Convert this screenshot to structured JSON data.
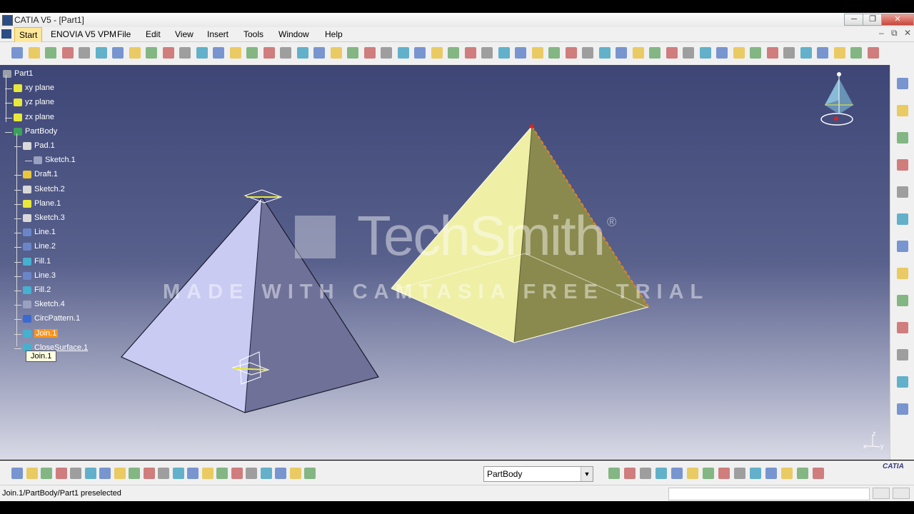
{
  "window": {
    "title": "CATIA V5 - [Part1]",
    "min_label": "─",
    "max_label": "❐",
    "close_label": "✕"
  },
  "menubar": {
    "items": [
      "Start",
      "ENOVIA V5 VPM",
      "File",
      "Edit",
      "View",
      "Insert",
      "Tools",
      "Window",
      "Help"
    ],
    "doc_controls": [
      "–",
      "⧉",
      "✕"
    ]
  },
  "tree": {
    "root": "Part1",
    "items": [
      "xy plane",
      "yz plane",
      "zx plane",
      "PartBody",
      "Pad.1",
      "Sketch.1",
      "Draft.1",
      "Sketch.2",
      "Plane.1",
      "Sketch.3",
      "Line.1",
      "Line.2",
      "Fill.1",
      "Line.3",
      "Fill.2",
      "Sketch.4",
      "CircPattern.1",
      "Join.1",
      "CloseSurface.1"
    ],
    "selected": "Join.1",
    "tooltip": "Join.1"
  },
  "watermark": {
    "brand": "TechSmith",
    "registered": "®",
    "tagline": "MADE WITH CAMTASIA FREE TRIAL"
  },
  "compass": {
    "axis_z": "z",
    "axis_x": "x",
    "axis_y": "y"
  },
  "bottom_toolbar": {
    "body_select_value": "PartBody",
    "logo": "CATIA"
  },
  "status": {
    "text": "Join.1/PartBody/Part1 preselected"
  },
  "colors": {
    "viewport_top": "#3d4676",
    "viewport_bottom": "#d9dae6",
    "left_pyramid_light": "#c9cbf2",
    "left_pyramid_dark": "#6f7199",
    "right_pyramid_light": "#efefa6",
    "right_pyramid_dark": "#8a8a4e",
    "selection_orange": "#e8801e",
    "highlight": "#f7941d"
  },
  "icons": {
    "top_toolbar": [
      "sketch-icon",
      "dim-icon",
      "part-icon",
      "pad-icon",
      "pocket-icon",
      "shaft-icon",
      "groove-icon",
      "hole-icon",
      "rib-icon",
      "slot-icon",
      "stiffener-icon",
      "loft-icon",
      "remove-loft-icon",
      "fillet-icon",
      "chamfer-icon",
      "draft-icon",
      "shell-icon",
      "thickness-icon",
      "thread-icon",
      "split-icon",
      "thick-surface-icon",
      "close-surface-icon",
      "sew-surface-icon",
      "translate-icon",
      "rotate-icon",
      "mirror-icon",
      "pattern-icon",
      "point-icon",
      "line-icon",
      "plane-icon",
      "point2-icon",
      "spline-icon",
      "helix-icon",
      "extrude-icon",
      "revolve-icon",
      "sphere-icon",
      "cylinder-icon",
      "join-icon",
      "healing-icon",
      "untrim-icon",
      "fly-icon",
      "fit-all-icon",
      "pan-icon",
      "rotate-view-icon",
      "zoom-in-icon",
      "zoom-out-icon",
      "normal-view-icon",
      "iso-view-icon",
      "shading-icon",
      "hide-show-icon",
      "swap-icon",
      "measure-icon"
    ],
    "bottom_toolbar": [
      "new-icon",
      "open-icon",
      "save-icon",
      "print-icon",
      "cut-icon",
      "copy-icon",
      "paste-icon",
      "undo-icon",
      "redo-icon",
      "whatsthis-icon",
      "formula-icon",
      "knowledge-icon",
      "law-icon",
      "table-icon",
      "catalog-icon",
      "scan-icon",
      "tree-icon",
      "apply-material-icon",
      "camera-icon",
      "render-icon",
      "compass-icon",
      "axis-icon",
      "filter-icon",
      "snap-icon",
      "ruler-icon",
      "layers-icon",
      "part-body-icon",
      "analysis-icon",
      "draft-analysis-icon",
      "curvature-icon",
      "apply-icon",
      "feature-icon",
      "transfer-icon",
      "lock-icon",
      "hand-icon"
    ],
    "right_toolbar": [
      "select-icon",
      "arrow-icon",
      "sphere-icon",
      "cube-icon",
      "cube2-icon",
      "gear-icon",
      "chain-icon",
      "link-icon",
      "measure-icon",
      "measure2-icon",
      "surface-icon",
      "group-icon",
      "cursor-icon"
    ]
  }
}
